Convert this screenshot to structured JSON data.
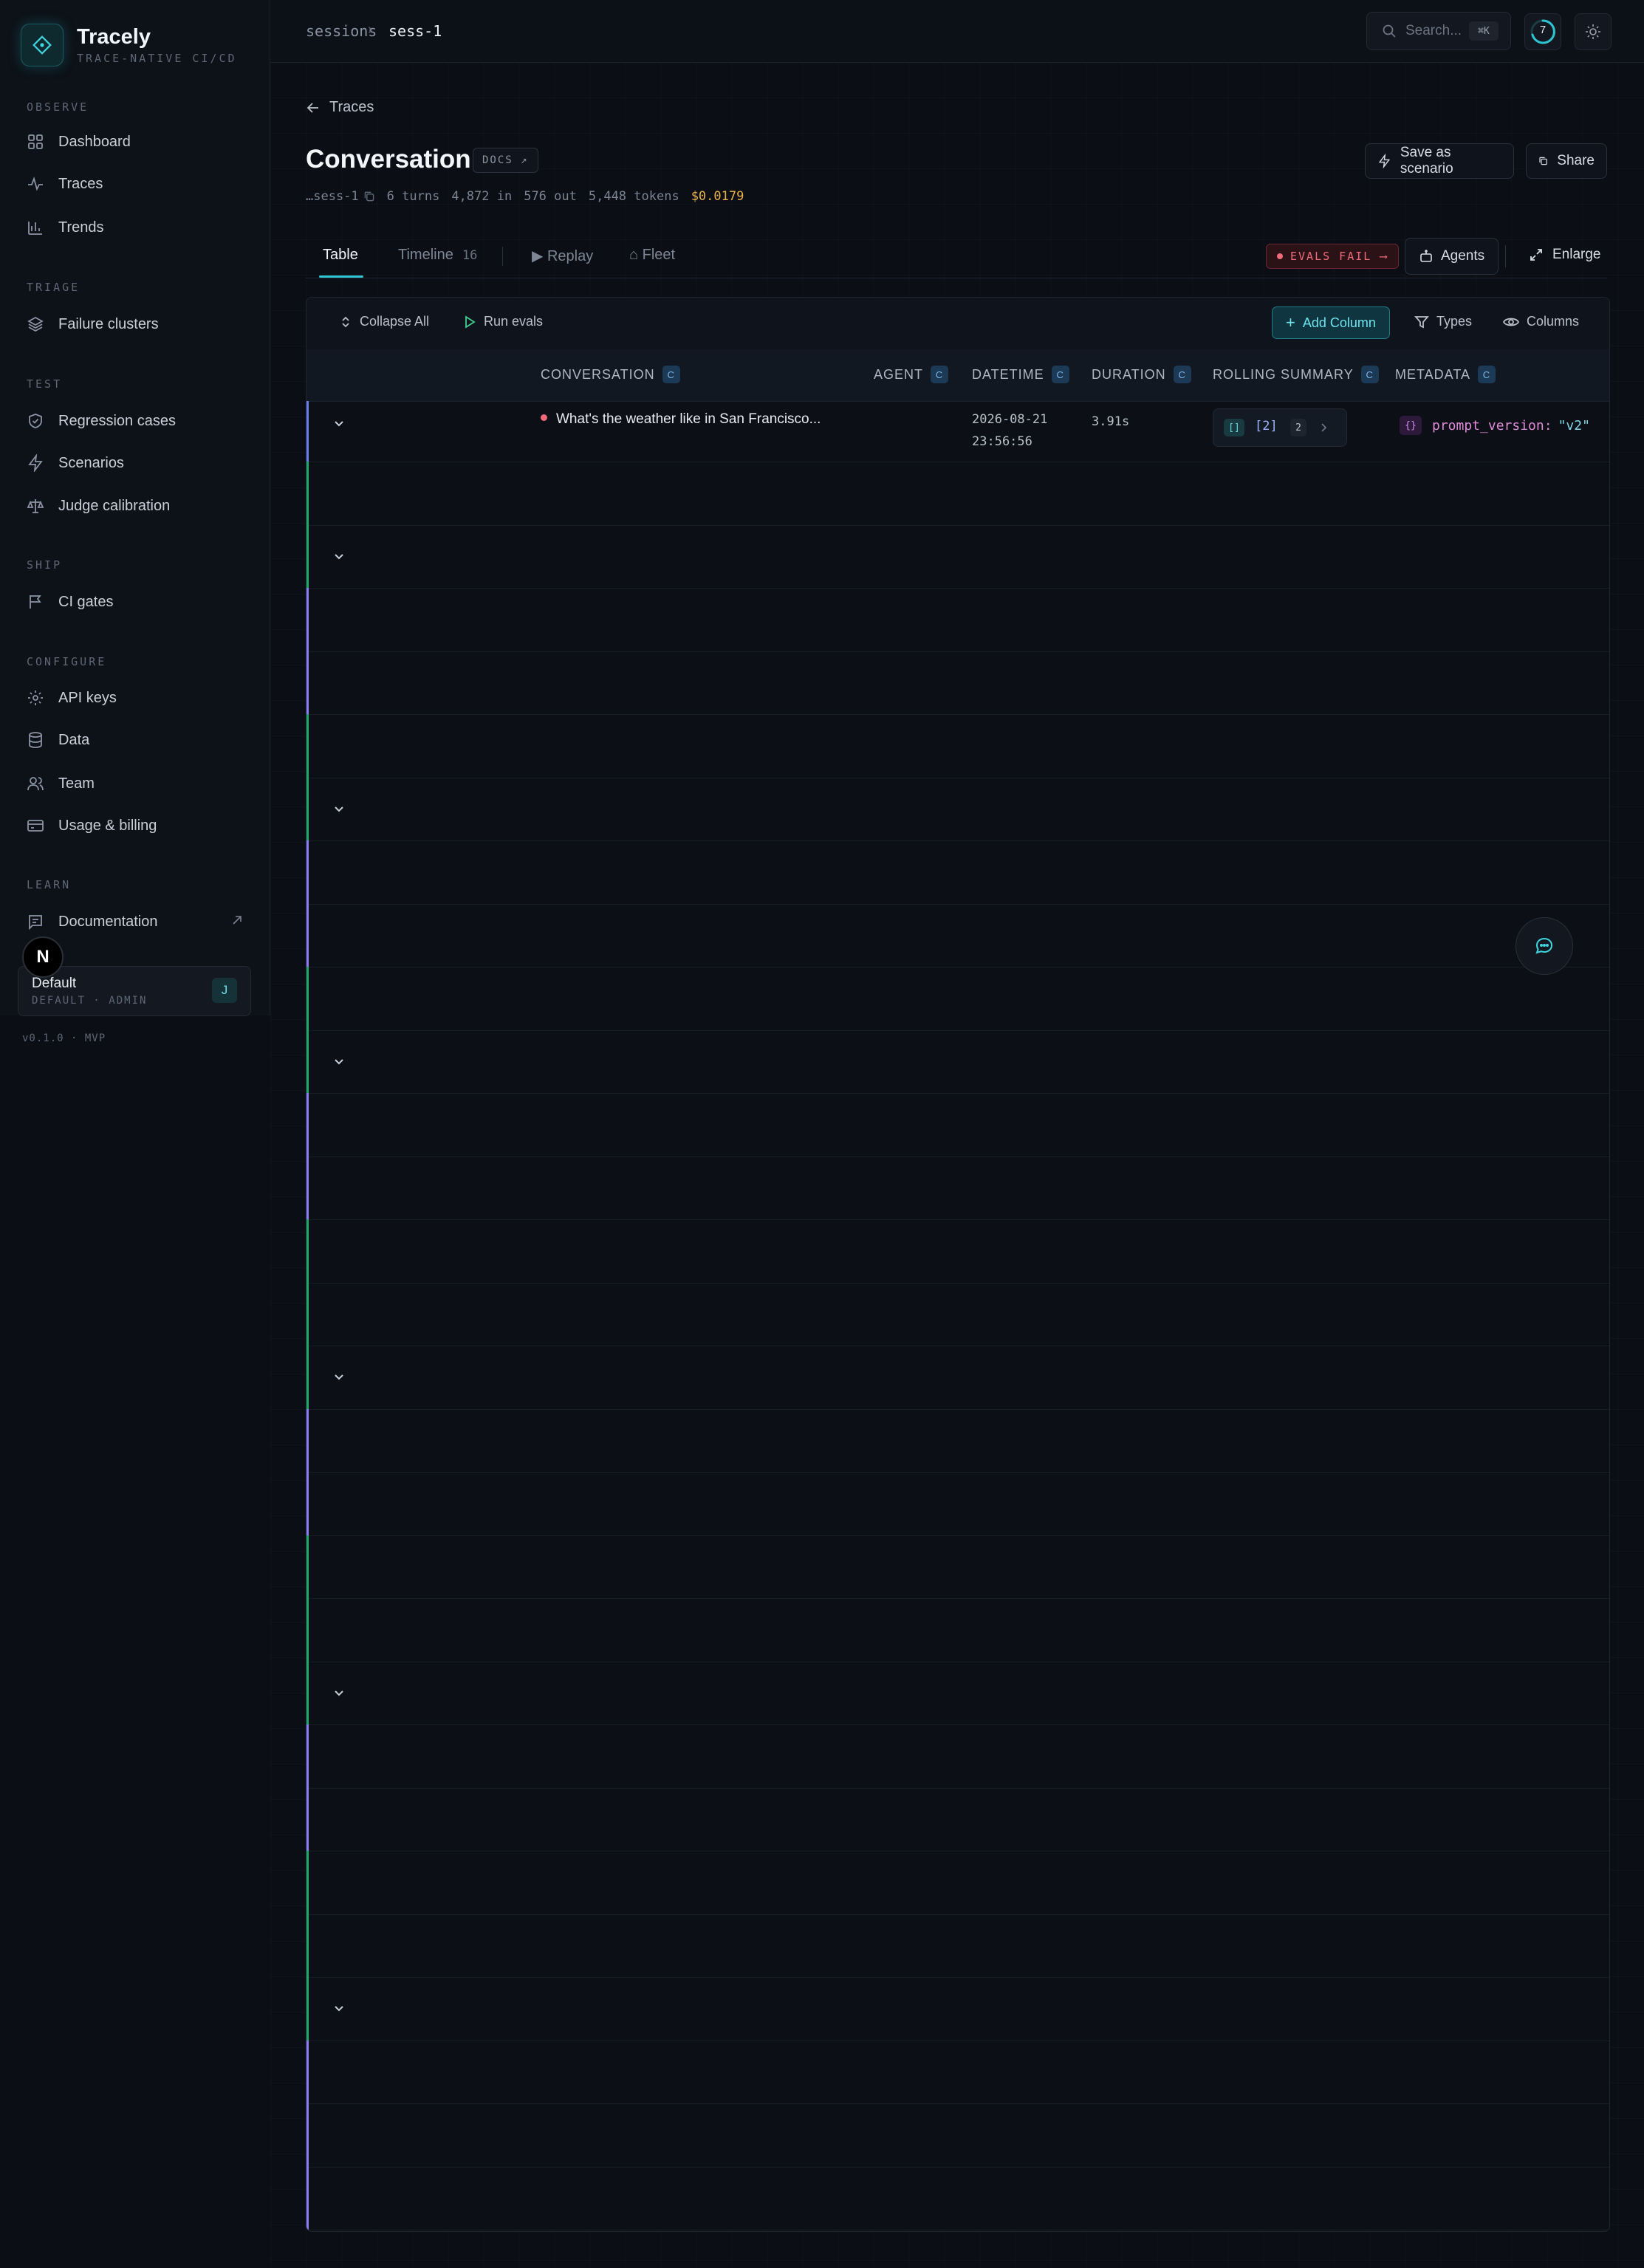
{
  "app": {
    "name": "Tracely",
    "tagline": "TRACE-NATIVE CI/CD",
    "version": "v0.1.0 · MVP"
  },
  "sidebar": {
    "sections": [
      {
        "label": "OBSERVE",
        "items": [
          {
            "label": "Dashboard",
            "icon": "grid-icon"
          },
          {
            "label": "Traces",
            "icon": "activity-icon"
          },
          {
            "label": "Trends",
            "icon": "bar-chart-icon"
          }
        ]
      },
      {
        "label": "TRIAGE",
        "items": [
          {
            "label": "Failure clusters",
            "icon": "layers-icon"
          }
        ]
      },
      {
        "label": "TEST",
        "items": [
          {
            "label": "Regression cases",
            "icon": "shield-check-icon"
          },
          {
            "label": "Scenarios",
            "icon": "zap-icon"
          },
          {
            "label": "Judge calibration",
            "icon": "scale-icon"
          }
        ]
      },
      {
        "label": "SHIP",
        "items": [
          {
            "label": "CI gates",
            "icon": "flag-icon"
          }
        ]
      },
      {
        "label": "CONFIGURE",
        "items": [
          {
            "label": "API keys",
            "icon": "gear-icon"
          },
          {
            "label": "Data",
            "icon": "database-icon"
          },
          {
            "label": "Team",
            "icon": "users-icon"
          },
          {
            "label": "Usage & billing",
            "icon": "card-icon"
          }
        ]
      },
      {
        "label": "LEARN",
        "items": [
          {
            "label": "Documentation",
            "icon": "book-icon"
          }
        ]
      }
    ],
    "user_initial": "N",
    "workspace": {
      "name": "Default",
      "role": "DEFAULT · ADMIN",
      "avatar": "J"
    }
  },
  "topbar": {
    "breadcrumb": [
      "sessions",
      "sess-1"
    ],
    "search_placeholder": "Search...",
    "search_shortcut": "⌘K",
    "notification_count": "7"
  },
  "header": {
    "back_label": "Traces",
    "title": "Conversation",
    "docs_badge": "DOCS ↗",
    "save_button": "Save as scenario",
    "share_button": "Share",
    "session_id": "…sess-1",
    "turns": "6 turns",
    "tokens_in": "4,872 in",
    "tokens_out": "576 out",
    "tokens_total": "5,448 tokens",
    "cost": "$0.0179"
  },
  "tabs": [
    {
      "label": "Table",
      "active": true
    },
    {
      "label": "Timeline",
      "count": "16"
    },
    {
      "label": "▶ Replay"
    },
    {
      "label": "⌂ Fleet"
    }
  ],
  "evals_badge": "EVALS FAIL ⟶",
  "agents_button": "Agents",
  "enlarge_button": "Enlarge",
  "toolbar": {
    "collapse_all": "Collapse All",
    "run_evals": "Run evals",
    "add_column": "Add Column",
    "types": "Types",
    "columns": "Columns"
  },
  "table": {
    "columns": [
      {
        "label": "CONVERSATION",
        "chip": "C"
      },
      {
        "label": "AGENT",
        "chip": "C"
      },
      {
        "label": "DATETIME",
        "chip": "C"
      },
      {
        "label": "DURATION",
        "chip": "C"
      },
      {
        "label": "ROLLING SUMMARY",
        "chip": "C"
      },
      {
        "label": "METADATA",
        "chip": "C"
      }
    ],
    "first_row": {
      "conversation": "What's the weather like in San Francisco...",
      "datetime_date": "2026-08-21",
      "datetime_time": "23:56:56",
      "duration": "3.91s",
      "summary_icon": "[]",
      "summary_value": "[2]",
      "summary_count": "2",
      "metadata_key": "prompt_version:",
      "metadata_value": "\"v2\"",
      "metadata_icon": "{}"
    }
  },
  "colors": {
    "accent": "#2ec4d2",
    "fail": "#f06a7a",
    "cost": "#e8b04a",
    "stripe_user": "#1fa86a",
    "stripe_agent": "#8b7cf6"
  }
}
